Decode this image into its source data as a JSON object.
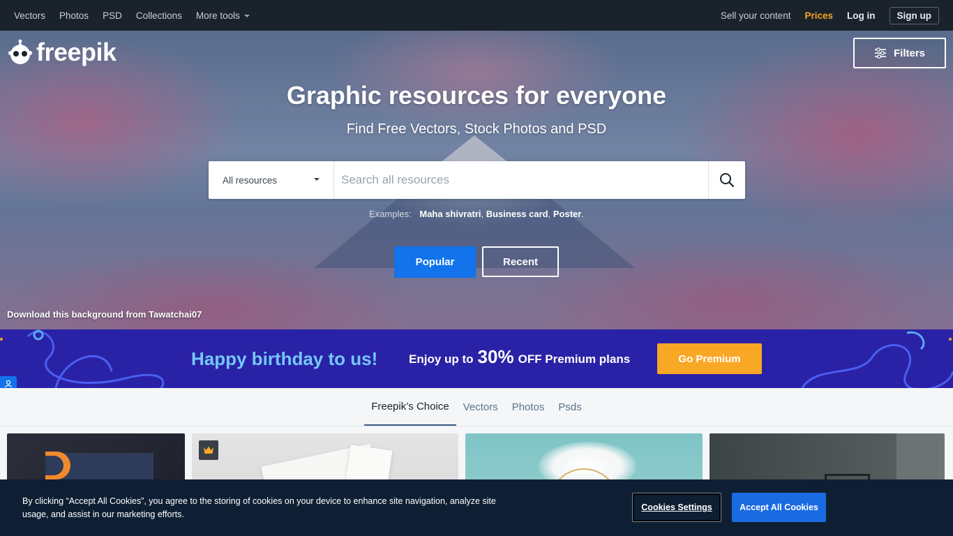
{
  "topnav": {
    "left": [
      "Vectors",
      "Photos",
      "PSD",
      "Collections"
    ],
    "more_tools": "More tools",
    "sell": "Sell your content",
    "prices": "Prices",
    "login": "Log in",
    "signup": "Sign up"
  },
  "logo": {
    "text": "freepik"
  },
  "filters": {
    "label": "Filters"
  },
  "hero": {
    "title": "Graphic resources for everyone",
    "subtitle": "Find Free Vectors, Stock Photos and PSD",
    "search": {
      "category": "All resources",
      "placeholder": "Search all resources"
    },
    "examples_label": "Examples:",
    "examples": [
      "Maha shivratri",
      "Business card",
      "Poster"
    ],
    "popular": "Popular",
    "recent": "Recent",
    "credit": "Download this background from Tawatchai07"
  },
  "banner": {
    "headline": "Happy birthday to us!",
    "offer_prefix": "Enjoy up to",
    "offer_pct": "30%",
    "offer_suffix": "OFF Premium plans",
    "cta": "Go Premium"
  },
  "tabs": [
    "Freepik’s Choice",
    "Vectors",
    "Photos",
    "Psds"
  ],
  "cookie": {
    "text": "By clicking “Accept All Cookies”, you agree to the storing of cookies on your device to enhance site navigation, analyze site usage, and assist in our marketing efforts.",
    "settings": "Cookies Settings",
    "accept": "Accept All Cookies"
  },
  "colors": {
    "nav_bg": "#1a222b",
    "accent_blue": "#1273eb",
    "prices": "#f5a623",
    "banner_bg": "#2a22a6",
    "banner_headline": "#74c7f7",
    "go_premium": "#f9a826",
    "cookie_bg": "#0e1f34"
  },
  "icons": [
    "freepik-mascot-icon",
    "filters-sliders-icon",
    "search-icon",
    "chevron-down-icon",
    "crown-icon",
    "user-icon"
  ]
}
